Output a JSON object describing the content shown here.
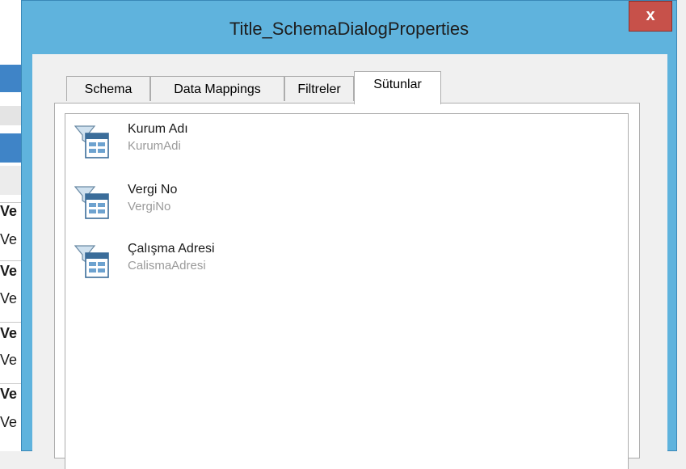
{
  "window": {
    "title": "Title_SchemaDialogProperties",
    "close_label": "x"
  },
  "tabs": [
    {
      "label": "Schema",
      "active": false
    },
    {
      "label": "Data Mappings",
      "active": false
    },
    {
      "label": "Filtreler",
      "active": false
    },
    {
      "label": "Sütunlar",
      "active": true
    }
  ],
  "columns": [
    {
      "label": "Kurum Adı",
      "field": "KurumAdi",
      "icon": "filter-table-icon"
    },
    {
      "label": "Vergi No",
      "field": "VergiNo",
      "icon": "filter-table-icon"
    },
    {
      "label": "Çalışma Adresi",
      "field": "CalismaAdresi",
      "icon": "filter-table-icon"
    }
  ],
  "background_fragments": [
    "Ve",
    "Ve",
    "Ve",
    "Ve",
    "Ve",
    "Ve",
    "Ve",
    "Ve"
  ],
  "colors": {
    "titlebar": "#5fb3dd",
    "close_button": "#c7514a",
    "background_accent": "#3f84c7"
  }
}
